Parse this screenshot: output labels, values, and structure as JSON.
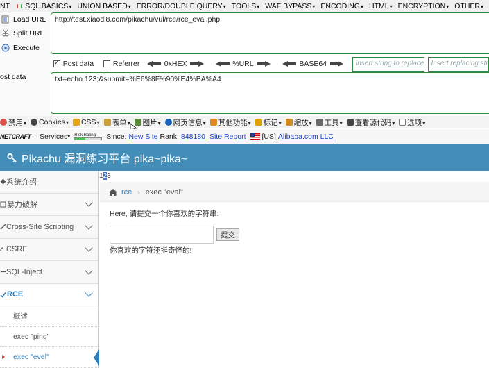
{
  "hackbar": {
    "menu": {
      "first": "NT",
      "items": [
        "SQL BASICS",
        "UNION BASED",
        "ERROR/DOUBLE QUERY",
        "TOOLS",
        "WAF BYPASS",
        "ENCODING",
        "HTML",
        "ENCRYPTION",
        "OTHER"
      ]
    },
    "buttons": {
      "load": "Load URL",
      "split": "Split URL",
      "execute": "Execute"
    },
    "url_value": "http://test.xiaodi8.com/pikachu/vul/rce/rce_eval.php",
    "options": {
      "post_data": "Post data",
      "post_checked": true,
      "referrer": "Referrer",
      "referrer_checked": false,
      "hex": "0xHEX",
      "url": "%URL",
      "base64": "BASE64",
      "replace_placeholder": "Insert string to replace",
      "replacing_placeholder": "Insert replacing string"
    },
    "post_label": "ost data",
    "post_value": "txt=echo 123;&submit=%E6%8F%90%E4%BA%A4"
  },
  "webdev_toolbar": {
    "items": [
      "禁用",
      "Cookies",
      "CSS",
      "表单",
      "图片",
      "网页信息",
      "其他功能",
      "标记",
      "缩放",
      "工具",
      "查看源代码",
      "选项"
    ],
    "icon_colors": [
      "#d9534f",
      "#444444",
      "#e8a317",
      "#c9a13a",
      "#5b8a3a",
      "#1e62c0",
      "#e08a1e",
      "#e0a000",
      "#d08a20",
      "#666666",
      "#444444",
      "#777777"
    ]
  },
  "netcraft": {
    "logo": "NETCRAFT",
    "services": "Services",
    "risk_label": "Risk Rating",
    "since_label": "Since:",
    "since_value": "New Site",
    "rank_label": "Rank:",
    "rank_value": "848180",
    "site_report": "Site Report",
    "country": "[US]",
    "host": "Alibaba.com LLC"
  },
  "site": {
    "title": "Pikachu 漏洞练习平台 pika~pika~",
    "colors": {
      "header": "#438eb9",
      "accent": "#2b7dbc"
    },
    "num_tag": {
      "pre": "1",
      "hl": "2",
      "post": "3"
    },
    "sidebar": {
      "items": [
        {
          "label": "系统介绍",
          "chevron": false
        },
        {
          "label": "暴力破解",
          "chevron": true
        },
        {
          "label": "Cross-Site Scripting",
          "chevron": true
        },
        {
          "label": "CSRF",
          "chevron": true
        },
        {
          "label": "SQL-Inject",
          "chevron": true
        },
        {
          "label": "RCE",
          "chevron": true
        }
      ],
      "sub_items": [
        "概述",
        "exec \"ping\"",
        "exec \"evel\""
      ]
    },
    "breadcrumb": {
      "root": "rce",
      "current": "exec \"eval\""
    },
    "prompt": "Here, 请提交一个你喜欢的字符串:",
    "submit_label": "提交",
    "result": "你喜欢的字符还挺奇怪的!"
  }
}
